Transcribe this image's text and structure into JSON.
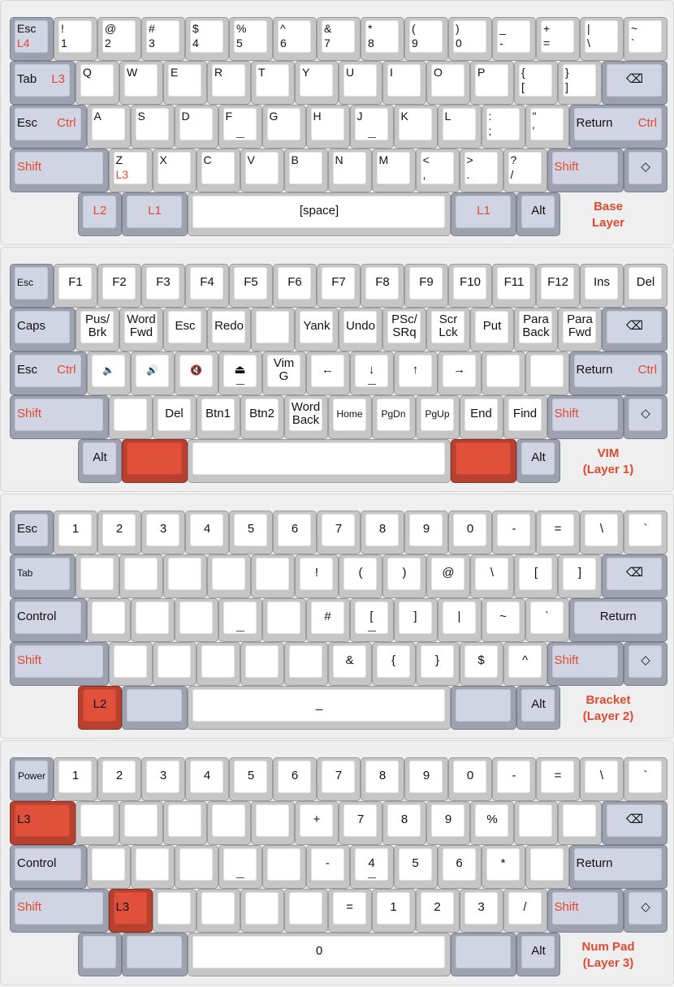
{
  "theme": {
    "white_key": "#ffffff",
    "mod_key": "#d0d4e3",
    "accent_key": "#e0503b",
    "label_red": "#e04a2f"
  },
  "layers": [
    {
      "name": "Base\nLayer",
      "rows": [
        [
          {
            "tl": "Esc",
            "bl": "L4",
            "blr": true,
            "c": "b"
          },
          {
            "tl": "!",
            "bl": "1"
          },
          {
            "tl": "@",
            "bl": "2"
          },
          {
            "tl": "#",
            "bl": "3"
          },
          {
            "tl": "$",
            "bl": "4"
          },
          {
            "tl": "%",
            "bl": "5"
          },
          {
            "tl": "^",
            "bl": "6"
          },
          {
            "tl": "&",
            "bl": "7"
          },
          {
            "tl": "*",
            "bl": "8"
          },
          {
            "tl": "(",
            "bl": "9"
          },
          {
            "tl": ")",
            "bl": "0"
          },
          {
            "tl": "_",
            "bl": "-"
          },
          {
            "tl": "+",
            "bl": "="
          },
          {
            "tl": "|",
            "bl": "\\"
          },
          {
            "tl": "~",
            "bl": "`"
          }
        ],
        [
          {
            "l": "Tab",
            "r": "L3",
            "c": "b"
          },
          {
            "tl": "Q"
          },
          {
            "tl": "W"
          },
          {
            "tl": "E"
          },
          {
            "tl": "R"
          },
          {
            "tl": "T"
          },
          {
            "tl": "Y"
          },
          {
            "tl": "U"
          },
          {
            "tl": "I"
          },
          {
            "tl": "O"
          },
          {
            "tl": "P"
          },
          {
            "tl": "{",
            "bl": "["
          },
          {
            "tl": "}",
            "bl": "]"
          },
          {
            "m": "⌫",
            "c": "b",
            "icon": "backspace-icon"
          }
        ],
        [
          {
            "l": "Esc",
            "r": "Ctrl",
            "c": "b"
          },
          {
            "tl": "A"
          },
          {
            "tl": "S"
          },
          {
            "tl": "D"
          },
          {
            "tl": "F",
            "hm": 1
          },
          {
            "tl": "G"
          },
          {
            "tl": "H"
          },
          {
            "tl": "J",
            "hm": 1
          },
          {
            "tl": "K"
          },
          {
            "tl": "L"
          },
          {
            "tl": ":",
            "bl": ";"
          },
          {
            "tl": "\"",
            "bl": "'"
          },
          {
            "l": "Return",
            "r": "Ctrl",
            "c": "b"
          }
        ],
        [
          {
            "l": "Shift",
            "lr": true,
            "c": "b"
          },
          {
            "tl": "Z",
            "bl": "L3",
            "blr": true
          },
          {
            "tl": "X"
          },
          {
            "tl": "C"
          },
          {
            "tl": "V"
          },
          {
            "tl": "B"
          },
          {
            "tl": "N"
          },
          {
            "tl": "M"
          },
          {
            "tl": "<",
            "bl": ","
          },
          {
            "tl": ">",
            "bl": "."
          },
          {
            "tl": "?",
            "bl": "/"
          },
          {
            "l": "Shift",
            "lr": true,
            "c": "b"
          },
          {
            "m": "◇",
            "c": "b",
            "icon": "diamond-icon"
          }
        ],
        [
          {
            "m": "L2",
            "mr": true,
            "c": "b"
          },
          {
            "m": "L1",
            "mr": true,
            "c": "b"
          },
          {
            "m": "[space]"
          },
          {
            "m": "L1",
            "mr": true,
            "c": "b"
          },
          {
            "m": "Alt",
            "c": "b"
          }
        ]
      ]
    },
    {
      "name": "VIM\n(Layer 1)",
      "rows": [
        [
          {
            "l": "Esc",
            "sm": true,
            "c": "b"
          },
          {
            "m": "F1"
          },
          {
            "m": "F2"
          },
          {
            "m": "F3"
          },
          {
            "m": "F4"
          },
          {
            "m": "F5"
          },
          {
            "m": "F6"
          },
          {
            "m": "F7"
          },
          {
            "m": "F8"
          },
          {
            "m": "F9"
          },
          {
            "m": "F10"
          },
          {
            "m": "F11"
          },
          {
            "m": "F12"
          },
          {
            "m": "Ins"
          },
          {
            "m": "Del"
          }
        ],
        [
          {
            "l": "Caps",
            "c": "b"
          },
          {
            "m": "Pus/\nBrk"
          },
          {
            "m": "Word\nFwd"
          },
          {
            "m": "Esc"
          },
          {
            "m": "Redo"
          },
          {
            "m": ""
          },
          {
            "m": "Yank"
          },
          {
            "m": "Undo"
          },
          {
            "m": "PSc/\nSRq"
          },
          {
            "m": "Scr\nLck"
          },
          {
            "m": "Put"
          },
          {
            "m": "Para\nBack"
          },
          {
            "m": "Para\nFwd"
          },
          {
            "m": "⌫",
            "c": "b",
            "icon": "backspace-icon"
          }
        ],
        [
          {
            "l": "Esc",
            "r": "Ctrl",
            "c": "b"
          },
          {
            "m": "🔈",
            "sm": true,
            "icon": "volume-down-icon"
          },
          {
            "m": "🔊",
            "sm": true,
            "icon": "volume-up-icon"
          },
          {
            "m": "🔇",
            "sm": true,
            "icon": "mute-icon"
          },
          {
            "m": "⏏",
            "icon": "eject-icon",
            "hm": 1
          },
          {
            "m": "Vim\nG"
          },
          {
            "m": "←",
            "icon": "arrow-left-icon"
          },
          {
            "m": "↓",
            "icon": "arrow-down-icon",
            "hm": 1
          },
          {
            "m": "↑",
            "icon": "arrow-up-icon"
          },
          {
            "m": "→",
            "icon": "arrow-right-icon"
          },
          {
            "m": ""
          },
          {
            "m": ""
          },
          {
            "l": "Return",
            "r": "Ctrl",
            "c": "b"
          }
        ],
        [
          {
            "l": "Shift",
            "lr": true,
            "c": "b"
          },
          {
            "m": ""
          },
          {
            "m": "Del"
          },
          {
            "m": "Btn1"
          },
          {
            "m": "Btn2"
          },
          {
            "m": "Word\nBack"
          },
          {
            "m": "Home",
            "sm": true
          },
          {
            "m": "PgDn",
            "sm": true
          },
          {
            "m": "PgUp",
            "sm": true
          },
          {
            "m": "End"
          },
          {
            "m": "Find"
          },
          {
            "l": "Shift",
            "lr": true,
            "c": "b"
          },
          {
            "m": "◇",
            "c": "b",
            "icon": "diamond-icon"
          }
        ],
        [
          {
            "m": "Alt",
            "c": "b"
          },
          {
            "m": "",
            "c": "r"
          },
          {
            "m": ""
          },
          {
            "m": "",
            "c": "r"
          },
          {
            "m": "Alt",
            "c": "b"
          }
        ]
      ]
    },
    {
      "name": "Bracket\n(Layer 2)",
      "rows": [
        [
          {
            "l": "Esc",
            "c": "b"
          },
          {
            "m": "1"
          },
          {
            "m": "2"
          },
          {
            "m": "3"
          },
          {
            "m": "4"
          },
          {
            "m": "5"
          },
          {
            "m": "6"
          },
          {
            "m": "7"
          },
          {
            "m": "8"
          },
          {
            "m": "9"
          },
          {
            "m": "0"
          },
          {
            "m": "-"
          },
          {
            "m": "="
          },
          {
            "m": "\\"
          },
          {
            "m": "`"
          }
        ],
        [
          {
            "l": "Tab",
            "sm": true,
            "c": "b"
          },
          {
            "m": ""
          },
          {
            "m": ""
          },
          {
            "m": ""
          },
          {
            "m": ""
          },
          {
            "m": ""
          },
          {
            "m": "!"
          },
          {
            "m": "("
          },
          {
            "m": ")"
          },
          {
            "m": "@"
          },
          {
            "m": "\\"
          },
          {
            "m": "["
          },
          {
            "m": "]"
          },
          {
            "m": "⌫",
            "c": "b",
            "icon": "backspace-icon"
          }
        ],
        [
          {
            "l": "Control",
            "c": "b"
          },
          {
            "m": ""
          },
          {
            "m": ""
          },
          {
            "m": ""
          },
          {
            "m": "",
            "hm": 1
          },
          {
            "m": ""
          },
          {
            "m": "#"
          },
          {
            "m": "[",
            "hm": 1
          },
          {
            "m": "]"
          },
          {
            "m": "|"
          },
          {
            "m": "~"
          },
          {
            "m": "`"
          },
          {
            "m": "Return",
            "c": "b"
          }
        ],
        [
          {
            "l": "Shift",
            "lr": true,
            "c": "b"
          },
          {
            "m": ""
          },
          {
            "m": ""
          },
          {
            "m": ""
          },
          {
            "m": ""
          },
          {
            "m": ""
          },
          {
            "m": "&"
          },
          {
            "m": "{"
          },
          {
            "m": "}"
          },
          {
            "m": "$"
          },
          {
            "m": "^"
          },
          {
            "l": "Shift",
            "lr": true,
            "c": "b"
          },
          {
            "m": "◇",
            "c": "b",
            "icon": "diamond-icon"
          }
        ],
        [
          {
            "m": "L2",
            "c": "r"
          },
          {
            "m": "",
            "c": "b"
          },
          {
            "m": "_"
          },
          {
            "m": "",
            "c": "b"
          },
          {
            "m": "Alt",
            "c": "b"
          }
        ]
      ]
    },
    {
      "name": "Num Pad\n(Layer 3)",
      "rows": [
        [
          {
            "m": "Power",
            "sm": true,
            "c": "b"
          },
          {
            "m": "1"
          },
          {
            "m": "2"
          },
          {
            "m": "3"
          },
          {
            "m": "4"
          },
          {
            "m": "5"
          },
          {
            "m": "6"
          },
          {
            "m": "7"
          },
          {
            "m": "8"
          },
          {
            "m": "9"
          },
          {
            "m": "0"
          },
          {
            "m": "-"
          },
          {
            "m": "="
          },
          {
            "m": "\\"
          },
          {
            "m": "`"
          }
        ],
        [
          {
            "l": "L3",
            "c": "r"
          },
          {
            "m": ""
          },
          {
            "m": ""
          },
          {
            "m": ""
          },
          {
            "m": ""
          },
          {
            "m": ""
          },
          {
            "m": "+"
          },
          {
            "m": "7"
          },
          {
            "m": "8"
          },
          {
            "m": "9"
          },
          {
            "m": "%"
          },
          {
            "m": ""
          },
          {
            "m": ""
          },
          {
            "m": "⌫",
            "c": "b",
            "icon": "backspace-icon"
          }
        ],
        [
          {
            "l": "Control",
            "c": "b"
          },
          {
            "m": ""
          },
          {
            "m": ""
          },
          {
            "m": ""
          },
          {
            "m": "",
            "hm": 1
          },
          {
            "m": ""
          },
          {
            "m": "-"
          },
          {
            "m": "4",
            "hm": 1
          },
          {
            "m": "5"
          },
          {
            "m": "6"
          },
          {
            "m": "*"
          },
          {
            "m": ""
          },
          {
            "l": "Return",
            "c": "b"
          }
        ],
        [
          {
            "l": "Shift",
            "lr": true,
            "c": "b"
          },
          {
            "l": "L3",
            "c": "r"
          },
          {
            "m": ""
          },
          {
            "m": ""
          },
          {
            "m": ""
          },
          {
            "m": ""
          },
          {
            "m": "="
          },
          {
            "m": "1"
          },
          {
            "m": "2"
          },
          {
            "m": "3"
          },
          {
            "m": "/"
          },
          {
            "l": "Shift",
            "lr": true,
            "c": "b"
          },
          {
            "m": "◇",
            "c": "b",
            "icon": "diamond-icon"
          }
        ],
        [
          {
            "m": "",
            "c": "b"
          },
          {
            "m": "",
            "c": "b"
          },
          {
            "m": "0"
          },
          {
            "m": "",
            "c": "b"
          },
          {
            "m": "Alt",
            "c": "b"
          }
        ]
      ]
    }
  ]
}
